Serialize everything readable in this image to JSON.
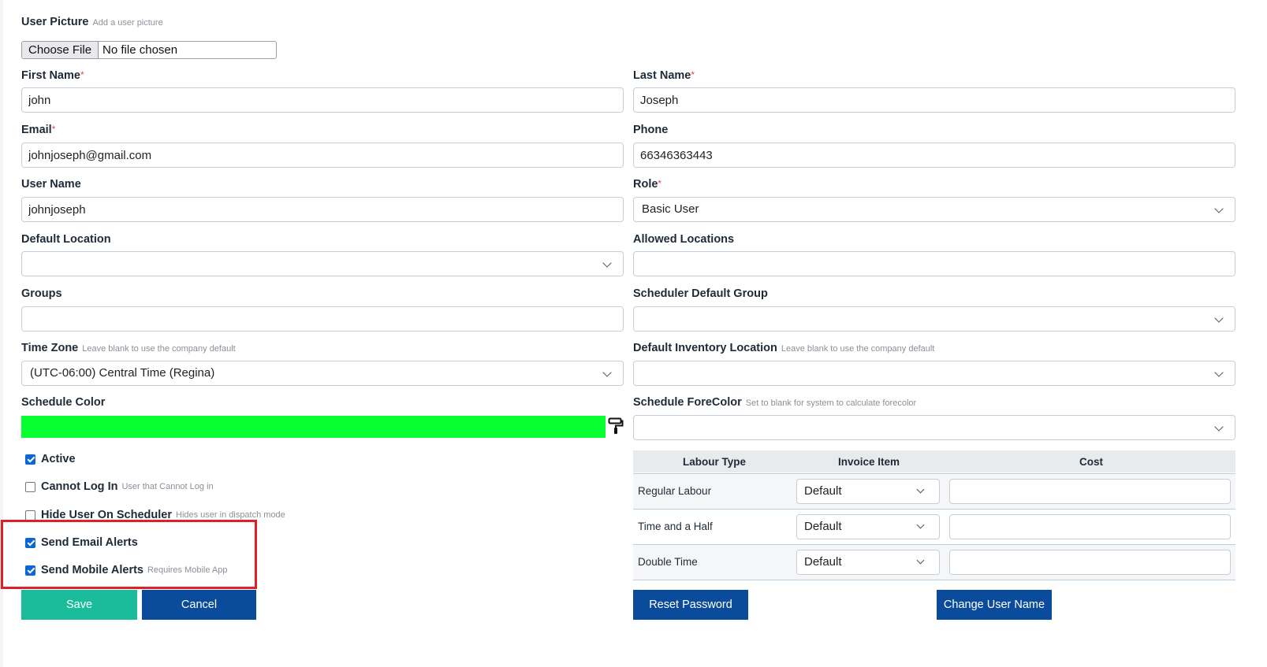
{
  "user_picture": {
    "label": "User Picture",
    "hint": "Add a user picture",
    "choose_file": "Choose File",
    "file_status": "No file chosen"
  },
  "first_name": {
    "label": "First Name",
    "required": "*",
    "value": "john"
  },
  "last_name": {
    "label": "Last Name",
    "required": "*",
    "value": "Joseph"
  },
  "email": {
    "label": "Email",
    "required": "*",
    "value": "johnjoseph@gmail.com"
  },
  "phone": {
    "label": "Phone",
    "value": "66346363443"
  },
  "user_name": {
    "label": "User Name",
    "value": "johnjoseph"
  },
  "role": {
    "label": "Role",
    "required": "*",
    "value": "Basic User"
  },
  "default_location": {
    "label": "Default Location",
    "value": ""
  },
  "allowed_locations": {
    "label": "Allowed Locations",
    "value": ""
  },
  "groups": {
    "label": "Groups",
    "value": ""
  },
  "scheduler_default_group": {
    "label": "Scheduler Default Group",
    "value": ""
  },
  "time_zone": {
    "label": "Time Zone",
    "hint": "Leave blank to use the company default",
    "value": "(UTC-06:00) Central Time (Regina)"
  },
  "default_inventory_location": {
    "label": "Default Inventory Location",
    "hint": "Leave blank to use the company default",
    "value": ""
  },
  "schedule_color": {
    "label": "Schedule Color",
    "color": "#08ff31"
  },
  "schedule_forecolor": {
    "label": "Schedule ForeColor",
    "hint": "Set to blank for system to calculate forecolor",
    "value": ""
  },
  "checkboxes": {
    "active": {
      "label": "Active",
      "checked": true
    },
    "cannot_log_in": {
      "label": "Cannot Log In",
      "hint": "User that Cannot Log in",
      "checked": false
    },
    "hide_user_on_scheduler": {
      "label": "Hide User On Scheduler",
      "hint": "Hides user in dispatch mode",
      "checked": false
    },
    "send_email_alerts": {
      "label": "Send Email Alerts",
      "checked": true
    },
    "send_mobile_alerts": {
      "label": "Send Mobile Alerts",
      "hint": "Requires Mobile App",
      "checked": true
    }
  },
  "labour_table": {
    "headers": [
      "Labour Type",
      "Invoice Item",
      "Cost"
    ],
    "rows": [
      {
        "type": "Regular Labour",
        "invoice_item": "Default",
        "cost": ""
      },
      {
        "type": "Time and a Half",
        "invoice_item": "Default",
        "cost": ""
      },
      {
        "type": "Double Time",
        "invoice_item": "Default",
        "cost": ""
      }
    ]
  },
  "buttons": {
    "save": "Save",
    "cancel": "Cancel",
    "reset_password": "Reset Password",
    "change_user_name": "Change User Name"
  },
  "icons": {
    "paint_roller": "paint-roller-icon",
    "chevron": "chevron-down-icon"
  },
  "colors": {
    "save": "#1abc9c",
    "primary": "#0a4b9b",
    "highlight": "#e01f26"
  }
}
